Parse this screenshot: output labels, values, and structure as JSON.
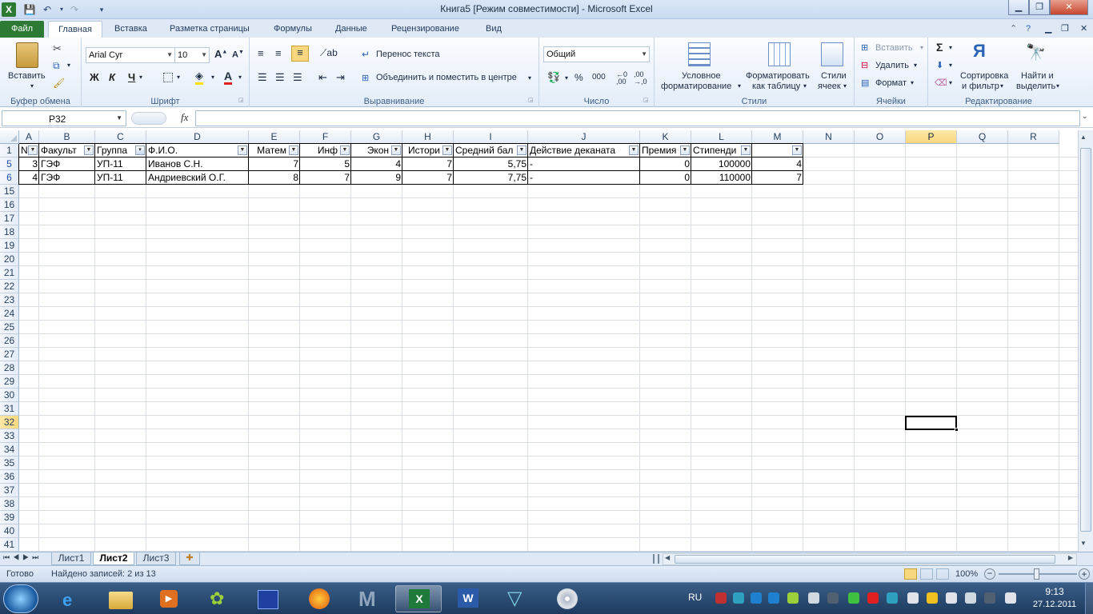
{
  "window": {
    "title": "Книга5  [Режим совместимости]  -  Microsoft Excel",
    "controls": {
      "minimize": "▁",
      "restore": "❐",
      "close": "✕"
    }
  },
  "ribbon_tabs": [
    {
      "label": "Файл"
    },
    {
      "label": "Главная"
    },
    {
      "label": "Вставка"
    },
    {
      "label": "Разметка страницы"
    },
    {
      "label": "Формулы"
    },
    {
      "label": "Данные"
    },
    {
      "label": "Рецензирование"
    },
    {
      "label": "Вид"
    }
  ],
  "ribbon": {
    "clipboard": {
      "paste": "Вставить",
      "group": "Буфер обмена"
    },
    "font": {
      "name": "Arial Cyr",
      "size": "10",
      "bold": "Ж",
      "italic": "К",
      "underline": "Ч",
      "group": "Шрифт"
    },
    "alignment": {
      "wrap": "Перенос текста",
      "merge": "Объединить и поместить в центре",
      "group": "Выравнивание"
    },
    "number": {
      "format": "Общий",
      "percent": "%",
      "thousands": "000",
      "group": "Число"
    },
    "styles": {
      "conditional_1": "Условное",
      "conditional_2": "форматирование",
      "table_1": "Форматировать",
      "table_2": "как таблицу",
      "cell_1": "Стили",
      "cell_2": "ячеек",
      "group": "Стили"
    },
    "cells": {
      "insert": "Вставить",
      "delete": "Удалить",
      "format": "Формат",
      "group": "Ячейки"
    },
    "editing": {
      "sum": "Σ",
      "sort_1": "Сортировка",
      "sort_2": "и фильтр",
      "find_1": "Найти и",
      "find_2": "выделить",
      "group": "Редактирование"
    }
  },
  "formula_bar": {
    "name_box": "P32",
    "fx": "fx",
    "formula": ""
  },
  "columns": [
    "A",
    "B",
    "C",
    "D",
    "E",
    "F",
    "G",
    "H",
    "I",
    "J",
    "K",
    "L",
    "M",
    "N",
    "O",
    "P",
    "Q",
    "R"
  ],
  "rows": [
    "1",
    "5",
    "6",
    "15",
    "16",
    "17",
    "18",
    "19",
    "20",
    "21",
    "22",
    "23",
    "24",
    "25",
    "26",
    "27",
    "28",
    "29",
    "30",
    "31",
    "32",
    "33",
    "34",
    "35",
    "36",
    "37",
    "38",
    "39",
    "40",
    "41"
  ],
  "headers": [
    "N",
    "Факульт",
    "Группа",
    "Ф.И.О.",
    "Матем",
    "Инф",
    "Экон",
    "Истори",
    "Средний бал",
    "Действие деканата",
    "Премия",
    "Стипенди",
    ""
  ],
  "data_rows": [
    [
      "3",
      "ГЭФ",
      "УП-11",
      "Иванов С.Н.",
      "7",
      "5",
      "4",
      "7",
      "5,75",
      "-",
      "0",
      "100000",
      "4"
    ],
    [
      "4",
      "ГЭФ",
      "УП-11",
      "Андриевский О.Г.",
      "8",
      "7",
      "9",
      "7",
      "7,75",
      "-",
      "0",
      "110000",
      "7"
    ]
  ],
  "sheets": [
    {
      "label": "Лист1"
    },
    {
      "label": "Лист2"
    },
    {
      "label": "Лист3"
    }
  ],
  "status": {
    "ready": "Готово",
    "found": "Найдено записей: 2 из 13",
    "zoom": "100%"
  },
  "taskbar": {
    "lang": "RU",
    "time": "9:13",
    "date": "27.12.2011"
  },
  "colors": {
    "file_tab": "#2c7a34",
    "selected_header": "#f9d77e",
    "taskbar": "#1d3a5e"
  }
}
